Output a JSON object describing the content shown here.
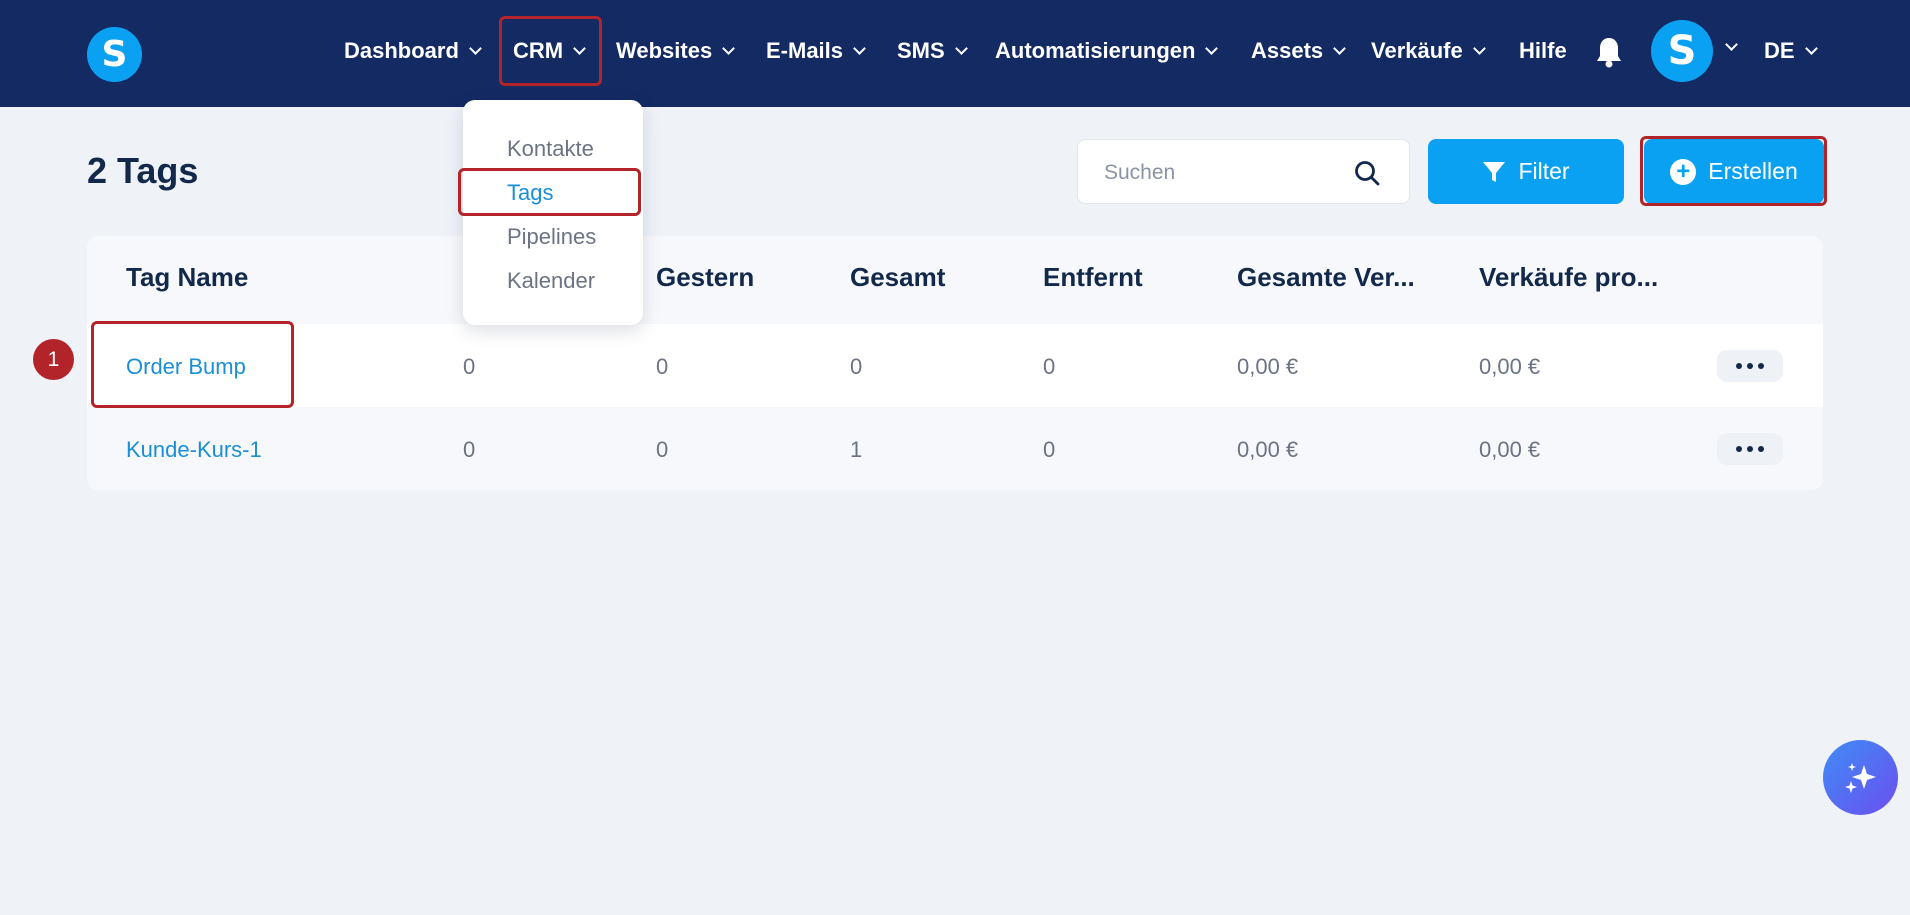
{
  "nav": {
    "items": [
      {
        "label": "Dashboard"
      },
      {
        "label": "CRM"
      },
      {
        "label": "Websites"
      },
      {
        "label": "E-Mails"
      },
      {
        "label": "SMS"
      },
      {
        "label": "Automatisierungen"
      },
      {
        "label": "Assets"
      },
      {
        "label": "Verkäufe"
      },
      {
        "label": "Hilfe"
      }
    ],
    "logo_letter": "S",
    "avatar_letter": "S",
    "language": "DE",
    "icons": {
      "notifications": "bell-icon",
      "dropdown": "chevron-down-icon"
    }
  },
  "crm_menu": {
    "items": [
      {
        "label": "Kontakte"
      },
      {
        "label": "Tags"
      },
      {
        "label": "Pipelines"
      },
      {
        "label": "Kalender"
      }
    ],
    "active": "Tags"
  },
  "page": {
    "title": "2 Tags",
    "search_placeholder": "Suchen",
    "filter_label": "Filter",
    "create_label": "Erstellen"
  },
  "table": {
    "columns": [
      "Tag Name",
      "Gestern",
      "Gesamt",
      "Entfernt",
      "Gesamte Ver...",
      "Verkäufe pro..."
    ],
    "rows": [
      {
        "name": "Order Bump",
        "c1": "0",
        "c2": "0",
        "c3": "0",
        "c4": "0",
        "c5": "0,00 €",
        "c6": "0,00 €"
      },
      {
        "name": "Kunde-Kurs-1",
        "c1": "0",
        "c2": "0",
        "c3": "1",
        "c4": "0",
        "c5": "0,00 €",
        "c6": "0,00 €"
      }
    ]
  },
  "annotation": {
    "step": "1"
  },
  "colors": {
    "nav_bg": "#132a62",
    "accent": "#0aa1f2",
    "highlight": "#b3242a",
    "link": "#1a8fd6",
    "page_bg": "#eff2f7"
  }
}
